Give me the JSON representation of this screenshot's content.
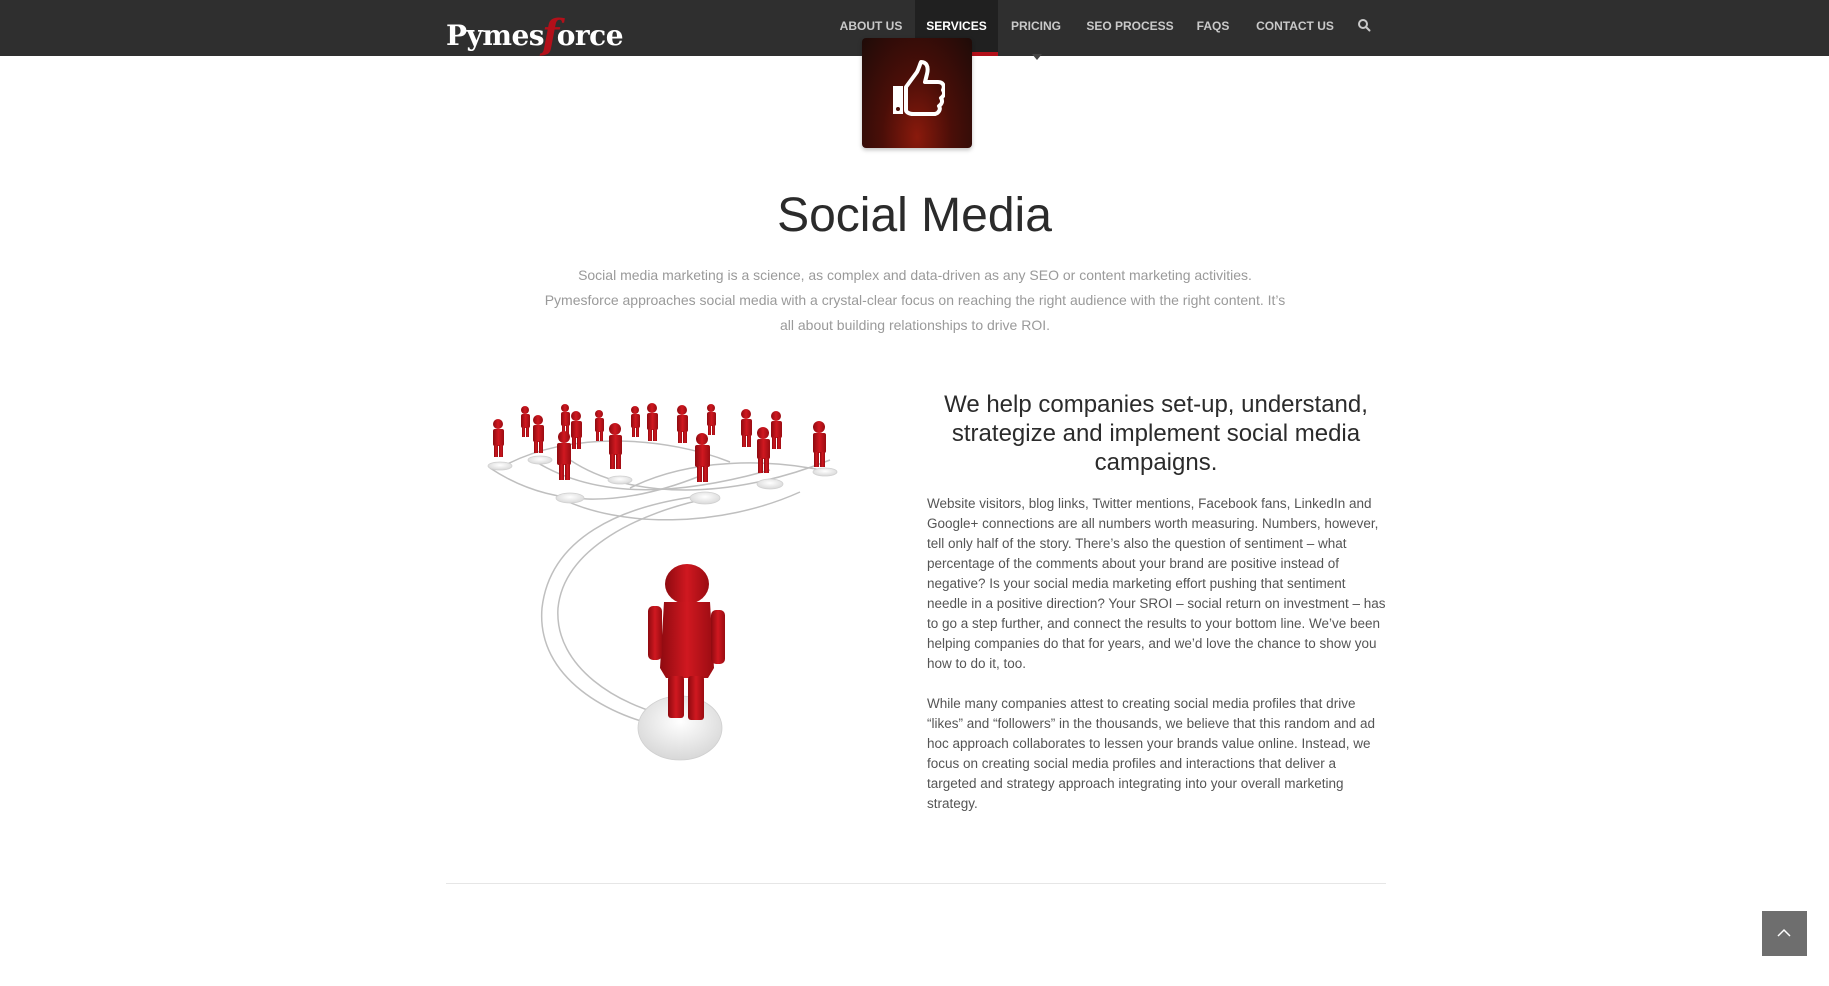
{
  "header": {
    "logo_text_left": "Pymes",
    "logo_text_f": "f",
    "logo_text_right": "orce",
    "nav": [
      {
        "label": "ABOUT US",
        "active": false
      },
      {
        "label": "SERVICES",
        "active": true
      },
      {
        "label": "PRICING",
        "active": false
      },
      {
        "label": "SEO PROCESS",
        "active": false
      },
      {
        "label": "FAQS",
        "active": false
      },
      {
        "label": "CONTACT US",
        "active": false
      }
    ]
  },
  "service": {
    "icon": "thumbs-up-icon",
    "title": "Social Media",
    "intro": "Social media marketing is a science, as complex and data-driven as any SEO or content marketing activities. Pymesforce approaches social media with a crystal-clear focus on reaching the right audience with the right content. It’s all about building relationships to drive ROI.",
    "heading": "We help companies set-up, understand, strategize and implement social media campaigns.",
    "paragraphs": [
      "Website visitors, blog links, Twitter mentions, Facebook fans, LinkedIn and Google+ connections are all numbers worth measuring. Numbers, however, tell only half of the story. There’s also the question of sentiment – what percentage of the comments about your brand are positive instead of negative? Is your social media marketing effort pushing that sentiment needle in a positive direction? Your SROI – social return on investment – has to go a step further, and connect the results to your bottom line. We’ve been helping companies do that for years, and we’d love the chance to show you how to do it, too.",
      "While many companies attest to creating social media profiles that drive “likes” and “followers” in the thousands, we believe that this random and ad hoc approach collaborates to lessen your brands value online. Instead, we focus on creating social media profiles and interactions that deliver a targeted and strategy approach integrating into your overall marketing strategy."
    ]
  },
  "colors": {
    "topbar": "#2f2f2f",
    "accent": "#b3101a",
    "figure_red": "#c4141b"
  },
  "icons": {
    "search": "search-icon",
    "back_to_top": "chevron-up-icon"
  }
}
